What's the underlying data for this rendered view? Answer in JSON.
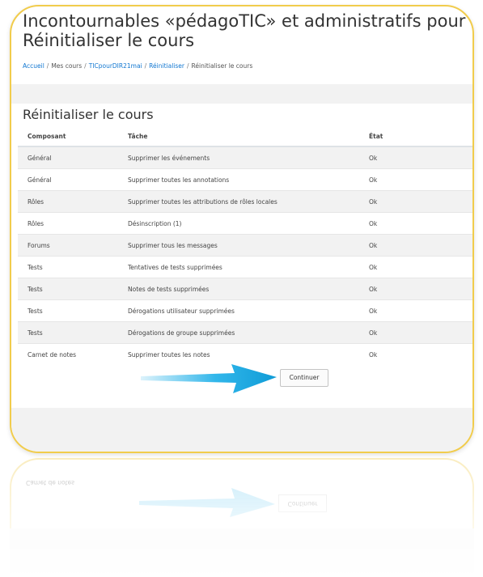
{
  "page": {
    "title": "Incontournables «pédagoTIC» et administratifs pour dir",
    "subtitle": "Réinitialiser le cours"
  },
  "breadcrumb": {
    "items": [
      "Accueil",
      "Mes cours",
      "TICpourDIR21mai",
      "Réinitialiser",
      "Réinitialiser le cours"
    ],
    "separator": "/"
  },
  "section": {
    "title": "Réinitialiser le cours"
  },
  "table": {
    "headers": [
      "Composant",
      "Tâche",
      "État"
    ],
    "rows": [
      [
        "Général",
        "Supprimer les événements",
        "Ok"
      ],
      [
        "Général",
        "Supprimer toutes les annotations",
        "Ok"
      ],
      [
        "Rôles",
        "Supprimer toutes les attributions de rôles locales",
        "Ok"
      ],
      [
        "Rôles",
        "Désinscription (1)",
        "Ok"
      ],
      [
        "Forums",
        "Supprimer tous les messages",
        "Ok"
      ],
      [
        "Tests",
        "Tentatives de tests supprimées",
        "Ok"
      ],
      [
        "Tests",
        "Notes de tests supprimées",
        "Ok"
      ],
      [
        "Tests",
        "Dérogations utilisateur supprimées",
        "Ok"
      ],
      [
        "Tests",
        "Dérogations de groupe supprimées",
        "Ok"
      ],
      [
        "Carnet de notes",
        "Supprimer toutes les notes",
        "Ok"
      ]
    ]
  },
  "actions": {
    "continue_label": "Continuer"
  },
  "colors": {
    "frame": "#f1cc4c",
    "link": "#1177d1",
    "arrow": "#1aaee8",
    "stripe": "#f2f2f2"
  },
  "icons": {
    "pointer": "right-arrow-icon"
  }
}
